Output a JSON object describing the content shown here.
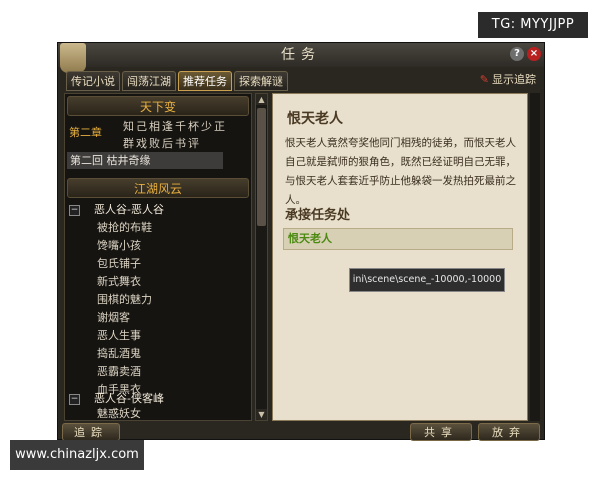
{
  "watermarks": {
    "top_right": "TG: MYYJJPP",
    "bottom_left": "www.chinazljx.com"
  },
  "window": {
    "title": "任务"
  },
  "tabs": [
    {
      "label": "传记小说",
      "active": false
    },
    {
      "label": "闯荡江湖",
      "active": false
    },
    {
      "label": "推荐任务",
      "active": true
    },
    {
      "label": "探索解谜",
      "active": false
    }
  ],
  "track_toggle": {
    "label": "显示追踪"
  },
  "left_panel": {
    "section1": {
      "title": "天下变",
      "chapter_label": "第二章",
      "chapter_lines": [
        "知己相逢千杯少正",
        "群戏败后书评"
      ],
      "selected": "第二回 枯井奇缘"
    },
    "section2": {
      "title": "江湖风云",
      "groups": [
        {
          "name": "恶人谷-恶人谷",
          "items": [
            "被抢的布鞋",
            "馋嘴小孩",
            "包氏铺子",
            "新式舞衣",
            "围棋的魅力",
            "谢烟客",
            "恶人生事",
            "捣乱酒鬼",
            "恶霸卖酒",
            "血手黑衣"
          ]
        },
        {
          "name": "恶人谷-侠客峰",
          "items": [
            "魅惑妖女"
          ]
        }
      ]
    }
  },
  "right_panel": {
    "npc_title": "恨天老人",
    "description": "恨天老人竟然夸奖他同门相残的徒弟，而恨天老人自己就是弑师的狠角色，既然已经证明自己无罪，与恨天老人套套近乎防止他躲袋一发热拍死最前之人。",
    "accept_title": "承接任务处",
    "accept_npc": "恨天老人",
    "tooltip": "ini\\scene\\scene_-10000,-10000"
  },
  "buttons": {
    "track": "追踪",
    "share": "共享",
    "abandon": "放弃"
  }
}
